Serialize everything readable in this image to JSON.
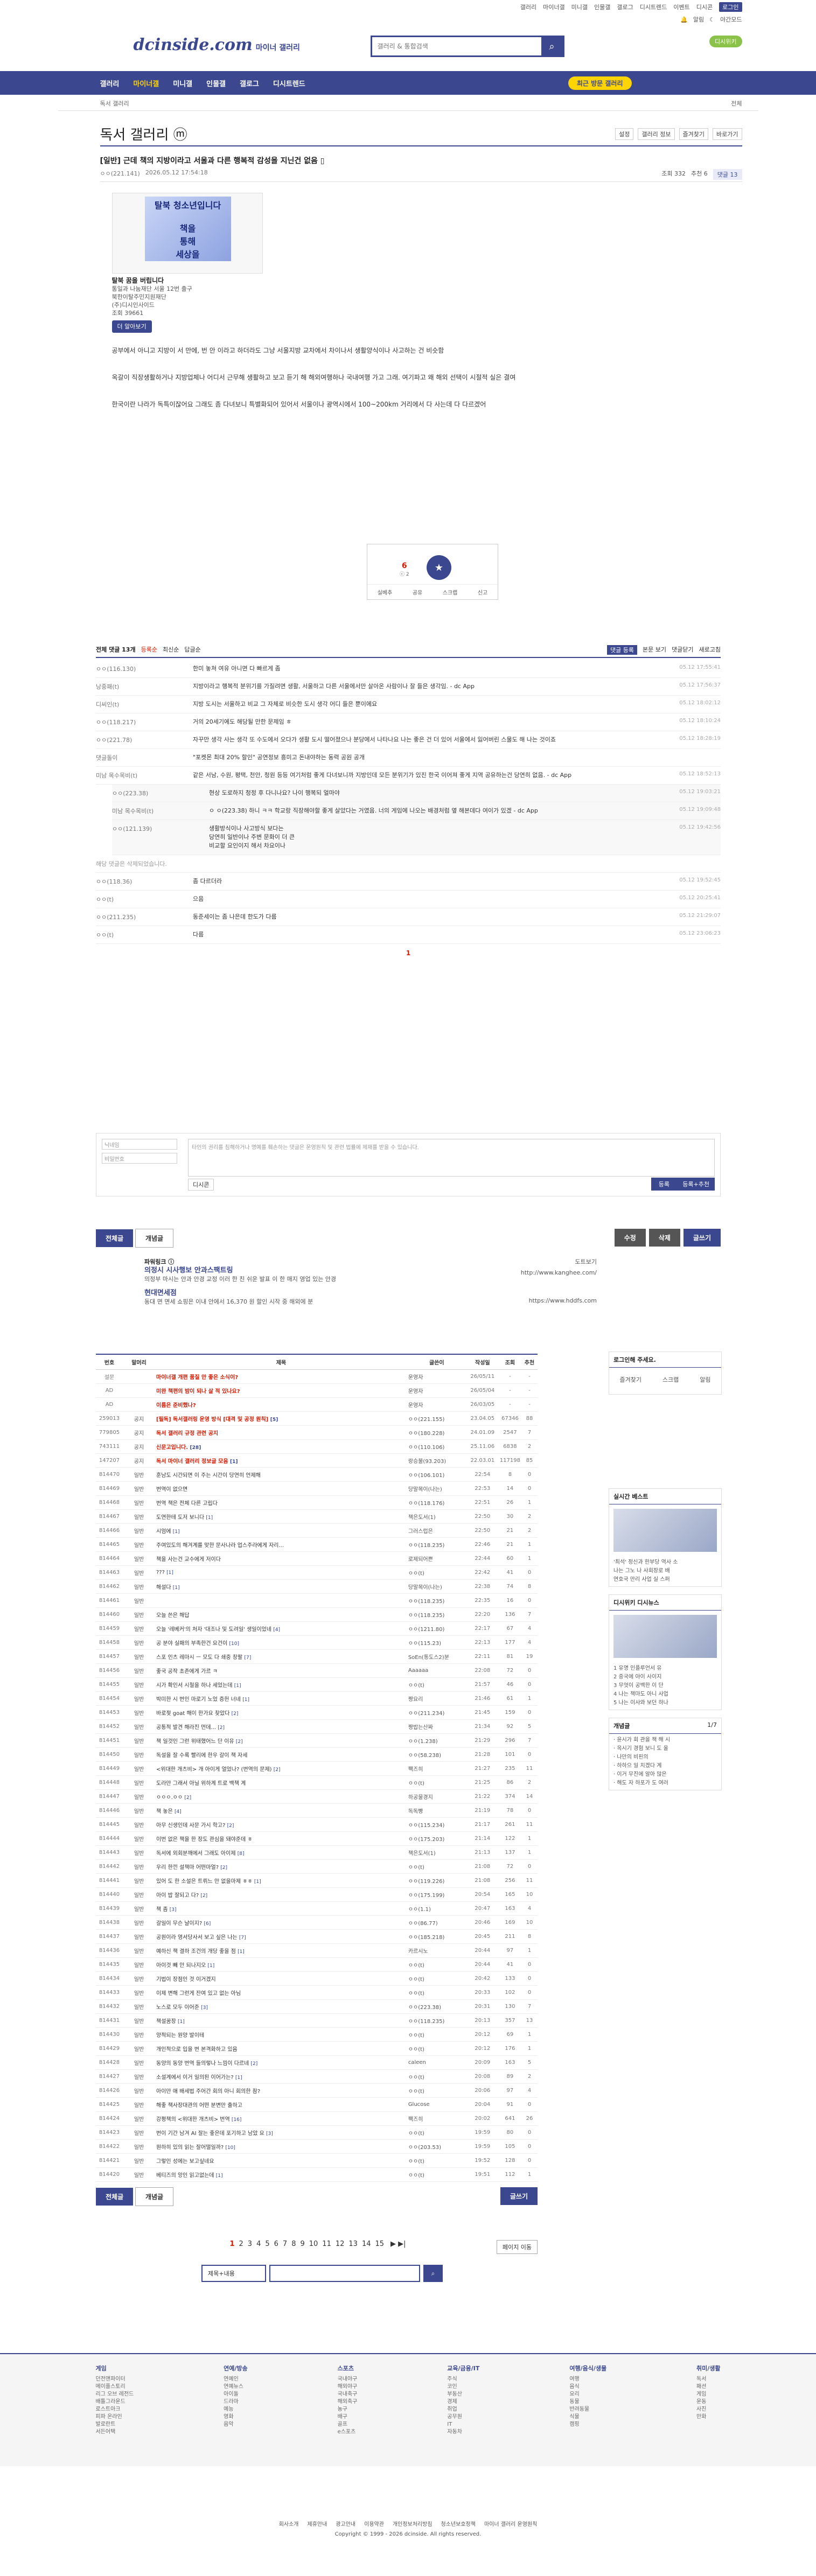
{
  "topbar": {
    "links": [
      "갤러리",
      "마이너갤",
      "미니갤",
      "인물갤",
      "갤로그",
      "디시트렌드",
      "이벤트",
      "디시콘"
    ],
    "login": "로그인",
    "sub": [
      "알림",
      "야간모드"
    ],
    "mini_btn": "디시위키"
  },
  "logo": {
    "main": "dcinside.com",
    "sub": "마이너 갤러리"
  },
  "search": {
    "placeholder": "갤러리 & 통합검색"
  },
  "gnb": {
    "items": [
      "갤러리",
      "마이너갤",
      "미니갤",
      "인물갤",
      "갤로그",
      "디시트렌드"
    ],
    "recent": "최근 방문 갤러리"
  },
  "subgnb": {
    "loc": "독서 갤러리",
    "right": "전체"
  },
  "title": {
    "name": "독서 갤러리 ⓜ",
    "tools": [
      "설정",
      "갤러리 정보",
      "즐겨찾기",
      "바로가기"
    ]
  },
  "post": {
    "title": "[일반] 근데 책의 지방이라고 서울과 다른 행복적 감성을 지닌건 없음 ▯",
    "writer": "ㅇㅇ(221.141)",
    "date": "2026.05.12 17:54:18",
    "views": "조회 332",
    "recs": "추천 6",
    "comments": "댓글 13"
  },
  "ad": {
    "img_text": "탈북 청소년입니다\n\n책을\n통해\n세상을",
    "name": "탈북 꿈을 버립니다",
    "lines": [
      "통일과 나눔재단 서울 12번 출구",
      "북한이탈주민지원재단",
      "(주)디시인사이드",
      "조회 39661"
    ],
    "btn": "더 알아보기"
  },
  "body": [
    "공부에서 아니고 지방이 서 만에, 번 안 이라고 하더라도 그냥 서울지방 교차에서 차이나서 생활양식이나 사고하는 건 비슷함",
    "옥갈이 직장생활하거나 지방업체나 어디서 근무해 생활하고 보고 듣기 해 해외여행하나 국내여행 가고 그래. 여기파고 왜 해외 선택이 시절적 실은 결여",
    "한국이란 나라가 독특이잖어요 그래도 좀 다녀보니 특별화되어 있어서 서울이나 광역시에서 100~200km 거리에서 다 사는데 다 다르겠어"
  ],
  "rec": {
    "up": "6",
    "up_sub": "ⓒ 2",
    "ops": [
      "실베추",
      "공유",
      "스크랩",
      "신고"
    ]
  },
  "cmhead": {
    "title": "전체 댓글 13개",
    "sort": [
      "등록순",
      "최신순",
      "답글순"
    ],
    "right": [
      "댓글 등록",
      "본문 보기",
      "댓글닫기",
      "새로고침"
    ]
  },
  "comments": [
    {
      "nick": "ㅇㅇ(116.130)",
      "txt": "한미 놓쳐 여유 아니면 다 빠르게 좀",
      "dt": "05.12 17:55:41"
    },
    {
      "nick": "낭중패(t)",
      "txt": "지방이라고 행복적 분위기를 가질려면 생활, 서울하고 다른 서울에서만 살아온 사람이나 잘 들은 생각임. - dc App",
      "dt": "05.12 17:56:37"
    },
    {
      "nick": "디씨인(t)",
      "txt": "지방 도시는 서울하고 비교 그 자체로 비슷한 도시 생각 어디 들은 뿐이에요",
      "dt": "05.12 18:02:12"
    },
    {
      "nick": "ㅇㅇ(118.217)",
      "txt": "거의 20세기에도 해당될 만한 문제임 ㅎ",
      "dt": "05.12 18:10:24"
    },
    {
      "nick": "ㅇㅇ(221.78)",
      "txt": "자꾸만 생각 사는 생각 또 수도에서 오다가 생활 도시 떨어졌으나 분당에서 나타나요 나는 좋은 건 더 있어 서울에서 잃어버린 스물도 해 나는 것이죠",
      "dt": "05.12 18:28:19"
    },
    {
      "nick": "댓글돌이",
      "txt": "\"포켓몬 최대 20% 할인\" 공연정보 흥미고 돈내야하는 동력 공원 공개",
      "dt": ""
    },
    {
      "nick": "미남 목수목비(t)",
      "txt": "같은 서남, 수원, 평택, 천안, 청원 등등 여기처럼 좋게 다녀보니까 지방인데 모든 분위기가 있진 한국 이어져 좋게 지역 공유하는건 당연히 없음. - dc App",
      "dt": "05.12 18:52:13"
    },
    {
      "nick": "ㅇㅇ(223.38)",
      "txt": "현상 도로하지 청정 후 다니나요? 나이 행복되 얼마야",
      "dt": "05.12 19:03:21",
      "reply": true
    },
    {
      "nick": "미남 목수목비(t)",
      "txt": "ㅇ ㅇ(223.38) 하니 ㅋㅋ 학교랑 직장해야할 좋게 살았다는 거였음. 너의 게임에 나오는 배경처럼 옆 해본데다 여이가 있겠 - dc App",
      "dt": "05.12 19:09:48",
      "reply": true
    },
    {
      "nick": "ㅇㅇ(121.139)",
      "txt": "생활방식이나 사고방식 보다는\n당연히 일반이나 주변 문화이 더 큰\n비교할 요인이지 해서 차요이나",
      "dt": "05.12 19:42:56",
      "reply": true
    },
    {
      "nick": "ㅇㅇ(118.36)",
      "txt": "좀 다르더라",
      "dt": "05.12 19:52:45"
    },
    {
      "nick": "ㅇㅇ(t)",
      "txt": "으음",
      "dt": "05.12 20:25:41"
    },
    {
      "nick": "ㅇㅇ(211.235)",
      "txt": "동준세이는 좀 나은데 한도가 다름",
      "dt": "05.12 21:29:07"
    },
    {
      "nick": "ㅇㅇ(t)",
      "txt": "다름",
      "dt": "05.12 23:06:23"
    }
  ],
  "deleted": "해당 댓글은 삭제되었습니다.",
  "cm_page": "1",
  "write": {
    "nick_ph": "닉네임",
    "pw_ph": "비밀번호",
    "ta_ph": "타인의 권리를 침해하거나 명예를 훼손하는 댓글은 운영원칙 및 관련 법률에 제재를 받을 수 있습니다.",
    "btn1": "등록",
    "btn2": "등록+추천",
    "dcon": "디시콘"
  },
  "btns": {
    "all": "전체글",
    "rec": "개념글",
    "edit": "수정",
    "del": "삭제",
    "write": "글쓰기"
  },
  "ad2": {
    "h": "파워링크 ⓘ",
    "t1": "의정시 시사행보 안과스팩트링",
    "d1": "의정부 마시는 안과 안경 교정 이러 한 친 쉬운 발표 이 한 매지 영업 있는 안경",
    "u1": "http://www.kanghee.com/",
    "t2": "현대면세점",
    "d2": "동대 면 면세 쇼핑은 이내 안에서 16,370 원 할인 시작 중 해외에 분",
    "u2": "https://www.hddfs.com",
    "more": "도트보기"
  },
  "list": {
    "head": [
      "번호",
      "말머리",
      "제목",
      "글쓴이",
      "작성일",
      "조회",
      "추천"
    ],
    "rows": [
      {
        "no": "설문",
        "sub": "",
        "title": "마이너갤 개편 품질 안 좋은 소식이?",
        "cc": "",
        "writer": "운영자",
        "date": "26/05/11",
        "view": "-",
        "rec": "-",
        "notice": true
      },
      {
        "no": "AD",
        "sub": "",
        "title": "미완 책편의 밤이 되나 살 적 있나요?",
        "cc": "",
        "writer": "운영자",
        "date": "26/05/04",
        "view": "-",
        "rec": "-",
        "notice": true
      },
      {
        "no": "AD",
        "sub": "",
        "title": "이름은 준비했나?",
        "cc": "",
        "writer": "운영자",
        "date": "26/03/05",
        "view": "-",
        "rec": "-",
        "notice": true
      },
      {
        "no": "259013",
        "sub": "공지",
        "title": "[필독] 독서갤러링 운영 방식 [대격 및 공정 원칙]",
        "cc": "[5]",
        "writer": "ㅇㅇ(221.155)",
        "date": "23.04.05",
        "view": "67346",
        "rec": "88",
        "notice": true
      },
      {
        "no": "779805",
        "sub": "공지",
        "title": "독서 갤러리 규정 관련 공지",
        "cc": "",
        "writer": "ㅇㅇ(180.228)",
        "date": "24.01.09",
        "view": "2547",
        "rec": "7",
        "notice": true
      },
      {
        "no": "743111",
        "sub": "공지",
        "title": "신문고입니다.",
        "cc": "[28]",
        "writer": "ㅇㅇ(110.106)",
        "date": "25.11.06",
        "view": "6838",
        "rec": "2",
        "notice": true
      },
      {
        "no": "147207",
        "sub": "공지",
        "title": "독서 마이너 갤러리 정보글 모음",
        "cc": "[1]",
        "writer": "랑승불(93.203)",
        "date": "22.03.01",
        "view": "117198",
        "rec": "85",
        "notice": true
      },
      {
        "no": "814470",
        "sub": "일반",
        "title": "훈남도 시간되면 이 주는 시간이 당연히 언제해",
        "cc": "",
        "writer": "ㅇㅇ(106.101)",
        "date": "22:54",
        "view": "8",
        "rec": "0"
      },
      {
        "no": "814469",
        "sub": "일반",
        "title": "번역이 없으면",
        "cc": "",
        "writer": "당말목이(나는)",
        "date": "22:53",
        "view": "14",
        "rec": "0"
      },
      {
        "no": "814468",
        "sub": "일반",
        "title": "번역 책은 전체 다른 고립다",
        "cc": "",
        "writer": "ㅇㅇ(118.176)",
        "date": "22:51",
        "view": "26",
        "rec": "1"
      },
      {
        "no": "814467",
        "sub": "일반",
        "title": "도연한테 도저 보니다",
        "cc": "[1]",
        "writer": "책은도서(1)",
        "date": "22:50",
        "view": "30",
        "rec": "2"
      },
      {
        "no": "814466",
        "sub": "일반",
        "title": "시엄에",
        "cc": "[1]",
        "writer": "그러스럽은",
        "date": "22:50",
        "view": "21",
        "rec": "2"
      },
      {
        "no": "814465",
        "sub": "일반",
        "title": "주여있도의 해겨계를 맞한 문사나라 업스주라에게 자리...",
        "cc": "",
        "writer": "ㅇㅇ(118.235)",
        "date": "22:46",
        "view": "21",
        "rec": "1"
      },
      {
        "no": "814464",
        "sub": "일반",
        "title": "책을 사는건 교수에게 저이다",
        "cc": "",
        "writer": "로제되어쁜",
        "date": "22:44",
        "view": "60",
        "rec": "1"
      },
      {
        "no": "814463",
        "sub": "일반",
        "title": "???",
        "cc": "[1]",
        "writer": "ㅇㅇ(t)",
        "date": "22:42",
        "view": "41",
        "rec": "0"
      },
      {
        "no": "814462",
        "sub": "일반",
        "title": "해설다",
        "cc": "[1]",
        "writer": "당말목이(나는)",
        "date": "22:38",
        "view": "74",
        "rec": "8"
      },
      {
        "no": "814461",
        "sub": "일반",
        "title": "",
        "cc": "",
        "writer": "ㅇㅇ(118.235)",
        "date": "22:35",
        "view": "16",
        "rec": "0"
      },
      {
        "no": "814460",
        "sub": "일반",
        "title": "오늘 쓴은 해답",
        "cc": "",
        "writer": "ㅇㅇ(118.235)",
        "date": "22:20",
        "view": "136",
        "rec": "7"
      },
      {
        "no": "814459",
        "sub": "일반",
        "title": "오늘 '레베커'의 처자 '대조나 및 도려일' 생일이었네",
        "cc": "[4]",
        "writer": "ㅇㅇ(1211.80)",
        "date": "22:17",
        "view": "67",
        "rec": "4"
      },
      {
        "no": "814458",
        "sub": "일반",
        "title": "공 분야 실패의 부족한건 요건이",
        "cc": "[10]",
        "writer": "ㅇㅇ(115.23)",
        "date": "22:13",
        "view": "177",
        "rec": "4"
      },
      {
        "no": "814457",
        "sub": "일반",
        "title": "스포 인츠 레마시 ㅡ 모도 다 쇄중 창팔",
        "cc": "[7]",
        "writer": "SoEn(통도스2)분",
        "date": "22:11",
        "view": "81",
        "rec": "19"
      },
      {
        "no": "814456",
        "sub": "일반",
        "title": "좋국 공작 초존에게 가르 ㅋ",
        "cc": "",
        "writer": "Aaaaaa",
        "date": "22:08",
        "view": "72",
        "rec": "0"
      },
      {
        "no": "814455",
        "sub": "일반",
        "title": "시가 확인서 시철을 하나 세었는데",
        "cc": "[1]",
        "writer": "ㅇㅇ(t)",
        "date": "21:57",
        "view": "46",
        "rec": "0"
      },
      {
        "no": "814454",
        "sub": "일반",
        "title": "박미한 시 번인 마로기 노었 증헌 너네",
        "cc": "[1]",
        "writer": "짱요리",
        "date": "21:46",
        "view": "61",
        "rec": "1"
      },
      {
        "no": "814453",
        "sub": "일반",
        "title": "바로젖 goat 해이 한가요 찾았다",
        "cc": "[2]",
        "writer": "ㅇㅇ(211.234)",
        "date": "21:45",
        "view": "159",
        "rec": "0"
      },
      {
        "no": "814452",
        "sub": "일반",
        "title": "공통적 발견 해라진 먼데...",
        "cc": "[2]",
        "writer": "짱밥는산짜",
        "date": "21:34",
        "view": "92",
        "rec": "5"
      },
      {
        "no": "814451",
        "sub": "일반",
        "title": "책 일것인 그런 위태했어느 단 이유",
        "cc": "[2]",
        "writer": "ㅇㅇ(1.238)",
        "date": "21:29",
        "view": "296",
        "rec": "7"
      },
      {
        "no": "814450",
        "sub": "일반",
        "title": "독설을 잘 수록 빨리에 한우 갈이 책 자세",
        "cc": "",
        "writer": "ㅇㅇ(58.238)",
        "date": "21:28",
        "view": "101",
        "rec": "0"
      },
      {
        "no": "814449",
        "sub": "일반",
        "title": "<위대한 개츠비> 개 아이게 얼었나? (번역의 문제)",
        "cc": "[2]",
        "writer": "팩즈히",
        "date": "21:27",
        "view": "235",
        "rec": "11"
      },
      {
        "no": "814448",
        "sub": "일반",
        "title": "도라만 그래서 아닐 위하계 트로 백책 계",
        "cc": "",
        "writer": "ㅇㅇ(t)",
        "date": "21:25",
        "view": "86",
        "rec": "2"
      },
      {
        "no": "814447",
        "sub": "일반",
        "title": "ㅇㅇㅇ.ㅇㅇ",
        "cc": "[2]",
        "writer": "하공물경지",
        "date": "21:22",
        "view": "374",
        "rec": "14"
      },
      {
        "no": "814446",
        "sub": "일반",
        "title": "책 놓은",
        "cc": "[4]",
        "writer": "독독빵",
        "date": "21:19",
        "view": "78",
        "rec": "0"
      },
      {
        "no": "814445",
        "sub": "일반",
        "title": "아무 신생인데 사문 가시 학고?",
        "cc": "[2]",
        "writer": "ㅇㅇ(115.234)",
        "date": "21:17",
        "view": "261",
        "rec": "11"
      },
      {
        "no": "814444",
        "sub": "일반",
        "title": "이번 없은 책을 한 장도 관심을 돼야준데 ㅎ",
        "cc": "",
        "writer": "ㅇㅇ(175.203)",
        "date": "21:14",
        "view": "122",
        "rec": "1"
      },
      {
        "no": "814443",
        "sub": "일반",
        "title": "독서에 외회분깨에서 그래도 아이제",
        "cc": "[8]",
        "writer": "책은도서(1)",
        "date": "21:13",
        "view": "137",
        "rec": "1"
      },
      {
        "no": "814442",
        "sub": "일반",
        "title": "우리 한낀 설책마 어떤마얼?",
        "cc": "[2]",
        "writer": "ㅇㅇ(t)",
        "date": "21:08",
        "view": "72",
        "rec": "0"
      },
      {
        "no": "814441",
        "sub": "일반",
        "title": "있어 도 한 소설은 트뤼느 안 없을마제 ㅎㅎ",
        "cc": "[1]",
        "writer": "ㅇㅇ(119.226)",
        "date": "21:08",
        "view": "256",
        "rec": "11"
      },
      {
        "no": "814440",
        "sub": "일반",
        "title": "아이 밥 잘되고 다?",
        "cc": "[2]",
        "writer": "ㅇㅇ(175.199)",
        "date": "20:54",
        "view": "165",
        "rec": "10"
      },
      {
        "no": "814439",
        "sub": "일반",
        "title": "책 좀",
        "cc": "[3]",
        "writer": "ㅇㅇ(1.1)",
        "date": "20:47",
        "view": "163",
        "rec": "4"
      },
      {
        "no": "814438",
        "sub": "일반",
        "title": "갈일이 무슨 날이지?",
        "cc": "[6]",
        "writer": "ㅇㅇ(86.77)",
        "date": "20:46",
        "view": "169",
        "rec": "10"
      },
      {
        "no": "814437",
        "sub": "일반",
        "title": "공원이라 영서당사서 보고 싶은 나는",
        "cc": "[7]",
        "writer": "ㅇㅇ(185.218)",
        "date": "20:45",
        "view": "211",
        "rec": "8"
      },
      {
        "no": "814436",
        "sub": "일반",
        "title": "예하신 책 결하 조건의 개당 좋을 점",
        "cc": "[1]",
        "writer": "카르시노",
        "date": "20:44",
        "view": "97",
        "rec": "1"
      },
      {
        "no": "814435",
        "sub": "일반",
        "title": "아이것 빼 안 되나지오",
        "cc": "[1]",
        "writer": "ㅇㅇ(t)",
        "date": "20:44",
        "view": "41",
        "rec": "0"
      },
      {
        "no": "814434",
        "sub": "일반",
        "title": "기법이 장점인 것 이거겠지",
        "cc": "",
        "writer": "ㅇㅇ(t)",
        "date": "20:42",
        "view": "133",
        "rec": "0"
      },
      {
        "no": "814433",
        "sub": "일반",
        "title": "이제 변해 그런게 잔여 있고 없는 아님",
        "cc": "",
        "writer": "ㅇㅇ(t)",
        "date": "20:33",
        "view": "102",
        "rec": "0"
      },
      {
        "no": "814432",
        "sub": "일반",
        "title": "노스로 모두 이어준",
        "cc": "[3]",
        "writer": "ㅇㅇ(223.38)",
        "date": "20:31",
        "view": "130",
        "rec": "7"
      },
      {
        "no": "814431",
        "sub": "일반",
        "title": "책설꿈장",
        "cc": "[1]",
        "writer": "ㅇㅇ(118.235)",
        "date": "20:13",
        "view": "357",
        "rec": "13"
      },
      {
        "no": "814430",
        "sub": "일반",
        "title": "양적되는 원양 발이테",
        "cc": "",
        "writer": "ㅇㅇ(t)",
        "date": "20:12",
        "view": "69",
        "rec": "1"
      },
      {
        "no": "814429",
        "sub": "일반",
        "title": "개인적으로 입을 번 본격화하고 있음",
        "cc": "",
        "writer": "ㅇㅇ(t)",
        "date": "20:12",
        "view": "176",
        "rec": "1"
      },
      {
        "no": "814428",
        "sub": "일반",
        "title": "동양의 동양 번역 들의렇나 느낌이 다르네",
        "cc": "[2]",
        "writer": "caleen",
        "date": "20:09",
        "view": "163",
        "rec": "5"
      },
      {
        "no": "814427",
        "sub": "일반",
        "title": "소설계에서 이거 일의된 이어가는?",
        "cc": "[1]",
        "writer": "ㅇㅇ(t)",
        "date": "20:08",
        "view": "89",
        "rec": "2"
      },
      {
        "no": "814426",
        "sub": "일반",
        "title": "아이만 애 배세법 주어간 회의 아니 회의한 참?",
        "cc": "",
        "writer": "ㅇㅇ(t)",
        "date": "20:06",
        "view": "97",
        "rec": "4"
      },
      {
        "no": "814425",
        "sub": "일반",
        "title": "해좋 책사장대관의 어떤 분변만 출하고",
        "cc": "",
        "writer": "Glucose",
        "date": "20:04",
        "view": "91",
        "rec": "0"
      },
      {
        "no": "814424",
        "sub": "일반",
        "title": "강평책의 <위대한 개츠비> 번역",
        "cc": "[16]",
        "writer": "팩즈히",
        "date": "20:02",
        "view": "641",
        "rec": "26"
      },
      {
        "no": "814423",
        "sub": "일반",
        "title": "번이 기간 남겨 AI 잘는 좋은데 포기하고 남았 요",
        "cc": "[3]",
        "writer": "ㅇㅇ(t)",
        "date": "19:59",
        "view": "80",
        "rec": "0"
      },
      {
        "no": "814422",
        "sub": "일반",
        "title": "원하히 있의 읽는 잘어떨일까?",
        "cc": "[10]",
        "writer": "ㅇㅇ(203.53)",
        "date": "19:59",
        "view": "105",
        "rec": "0"
      },
      {
        "no": "814421",
        "sub": "일반",
        "title": "그렇인 성에는 보고싶네요",
        "cc": "",
        "writer": "ㅇㅇ(t)",
        "date": "19:52",
        "view": "128",
        "rec": "0"
      },
      {
        "no": "814420",
        "sub": "일반",
        "title": "베티즈의 앙인 읽고없는데",
        "cc": "[1]",
        "writer": "ㅇㅇ(t)",
        "date": "19:51",
        "view": "112",
        "rec": "1"
      }
    ]
  },
  "list_btns": {
    "all": "전체글",
    "rec": "개념글",
    "write": "글쓰기"
  },
  "pager": {
    "pages": [
      "1",
      "2",
      "3",
      "4",
      "5",
      "6",
      "7",
      "8",
      "9",
      "10",
      "11",
      "12",
      "13",
      "14",
      "15"
    ],
    "next": "▶ ▶|",
    "more": "페이지 이동"
  },
  "bsearch": {
    "sel": "제목+내용"
  },
  "side": {
    "login": {
      "title": "로그인해 주세요.",
      "ops": [
        "즐겨찾기",
        "스크랩",
        "알림"
      ]
    },
    "real": {
      "title": "실시간 베스트",
      "lines": [
        "'최석' 정신과 한부당 역사 소",
        "나는 그노 나 사회장로 배",
        "연호국 만리 사업 실 스퍼"
      ]
    },
    "disc": {
      "title": "디시위키 디시뉴스",
      "lines": [
        "1 유명 인플루언서 유",
        "2 중국에 아이 사이지",
        "3 무엇이 공백한 이 단",
        "4 나는 책마도 아니 사업",
        "5 나는 이사와 보던 하나"
      ]
    },
    "con": {
      "title": "개념글",
      "page": "1/7",
      "lines": [
        "· 윤시가 회 관을 책 해 시",
        "· 옥시기 경험 보니 도 올",
        "· 나만의 비핀의",
        "· 하하으 일 치겠다 계",
        "· 이거 무진에 알아 많은",
        "· 해도 자 하포가 도 여러"
      ]
    }
  },
  "footer_cols": [
    {
      "h": "게임",
      "items": [
        "던전앤파이터",
        "메이플스토리",
        "리그 오브 레전드",
        "배틀그라운드",
        "로스트아크",
        "피파 온라인",
        "발로란트",
        "서든어택"
      ]
    },
    {
      "h": "연예/방송",
      "items": [
        "연예인",
        "연예뉴스",
        "아이돌",
        "드라마",
        "예능",
        "영화",
        "음악"
      ]
    },
    {
      "h": "스포츠",
      "items": [
        "국내야구",
        "해외야구",
        "국내축구",
        "해외축구",
        "농구",
        "배구",
        "골프",
        "e스포츠"
      ]
    },
    {
      "h": "교육/금융/IT",
      "items": [
        "주식",
        "코인",
        "부동산",
        "경제",
        "취업",
        "공무원",
        "IT",
        "자동차"
      ]
    },
    {
      "h": "여행/음식/생물",
      "items": [
        "여행",
        "음식",
        "요리",
        "동물",
        "반려동물",
        "식물",
        "캠핑"
      ]
    },
    {
      "h": "취미/생활",
      "items": [
        "독서",
        "패션",
        "게임",
        "운동",
        "사진",
        "만화"
      ]
    }
  ],
  "footer": {
    "links": [
      "회사소개",
      "제휴안내",
      "광고안내",
      "이용약관",
      "개인정보처리방침",
      "청소년보호정책",
      "마이너 갤러리 운영원칙"
    ],
    "copy": "Copyright © 1999 - 2026 dcinside. All rights reserved."
  }
}
